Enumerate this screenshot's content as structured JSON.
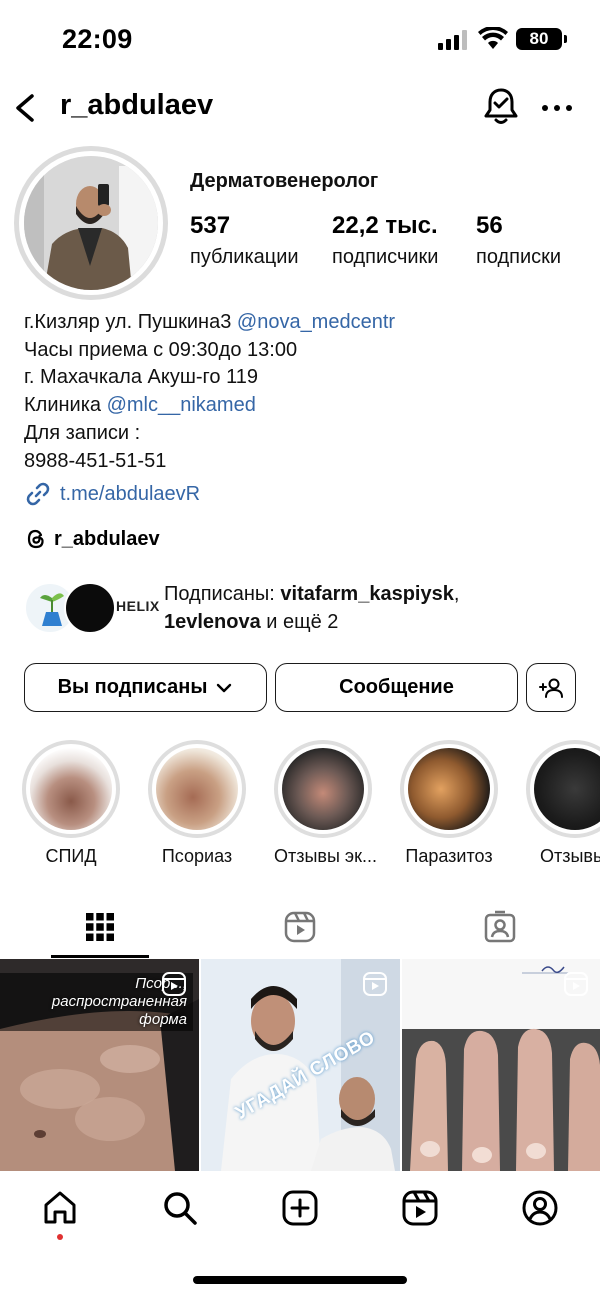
{
  "status_bar": {
    "time": "22:09",
    "battery": "80"
  },
  "header": {
    "username": "r_abdulaev"
  },
  "profile": {
    "category": "Дерматовенеролог",
    "stats": [
      {
        "num": "537",
        "label": "публикации"
      },
      {
        "num": "22,2 тыс.",
        "label": "подписчики"
      },
      {
        "num": "56",
        "label": "подписки"
      }
    ],
    "bio": {
      "line1_text": "г.Кизляр ул. Пушкина3 ",
      "line1_mention": "@nova_medcentr",
      "line2": "Часы приема с 09:30до 13:00",
      "line3": "г. Махачкала Акуш-го 119",
      "line4_text": "Клиника ",
      "line4_mention": "@mlc__nikamed",
      "line5": "Для записи :",
      "line6": "8988-451-51-51"
    },
    "link": "t.me/abdulaevR",
    "threads": "r_abdulaev",
    "followed_by": {
      "prefix": "Подписаны: ",
      "user1": "vitafarm_kaspiysk",
      "sep": ",",
      "user2": "1evlenova",
      "suffix": " и ещё 2",
      "avatar2_text": "HELIX"
    }
  },
  "buttons": {
    "following": "Вы подписаны",
    "message": "Сообщение"
  },
  "highlights": [
    {
      "label": "СПИД"
    },
    {
      "label": "Псориаз"
    },
    {
      "label": "Отзывы эк..."
    },
    {
      "label": "Паразитоз"
    },
    {
      "label": "Отзывы"
    }
  ],
  "grid": {
    "post1_caption_1": "Псор...,",
    "post1_caption_2": "распространенная форма",
    "post2_caption": "УГАДАЙ СЛОВО"
  },
  "colors": {
    "link": "#3566a6",
    "accent_dot": "#e03131"
  }
}
